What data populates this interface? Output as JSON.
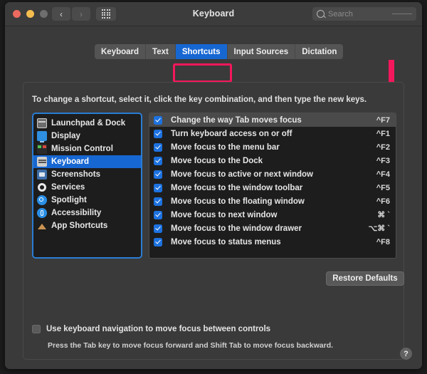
{
  "window": {
    "title": "Keyboard",
    "traffic_lights": [
      "close",
      "minimize",
      "zoom"
    ],
    "nav_back": "‹",
    "nav_forward": "›",
    "grid_button": "show-all-preferences"
  },
  "search": {
    "placeholder": "Search",
    "icon": "search-icon"
  },
  "tabs": [
    {
      "label": "Keyboard",
      "active": false
    },
    {
      "label": "Text",
      "active": false
    },
    {
      "label": "Shortcuts",
      "active": true
    },
    {
      "label": "Input Sources",
      "active": false
    },
    {
      "label": "Dictation",
      "active": false
    }
  ],
  "annotations": {
    "tab_highlight_color": "#f4175c",
    "arrow_color": "#f4175c",
    "arrow_target": "first-shortcut-row"
  },
  "instruction": "To change a shortcut, select it, click the key combination, and then type the new keys.",
  "sidebar": {
    "items": [
      {
        "label": "Launchpad & Dock",
        "icon": "launchpad-icon",
        "selected": false
      },
      {
        "label": "Display",
        "icon": "display-icon",
        "selected": false
      },
      {
        "label": "Mission Control",
        "icon": "mission-control-icon",
        "selected": false
      },
      {
        "label": "Keyboard",
        "icon": "keyboard-icon",
        "selected": true
      },
      {
        "label": "Screenshots",
        "icon": "screenshots-icon",
        "selected": false
      },
      {
        "label": "Services",
        "icon": "services-gear-icon",
        "selected": false
      },
      {
        "label": "Spotlight",
        "icon": "spotlight-icon",
        "selected": false
      },
      {
        "label": "Accessibility",
        "icon": "accessibility-icon",
        "selected": false
      },
      {
        "label": "App Shortcuts",
        "icon": "app-shortcuts-icon",
        "selected": false
      }
    ]
  },
  "shortcuts": {
    "rows": [
      {
        "label": "Change the way Tab moves focus",
        "key": "^F7",
        "checked": true,
        "selected": true
      },
      {
        "label": "Turn keyboard access on or off",
        "key": "^F1",
        "checked": true,
        "selected": false
      },
      {
        "label": "Move focus to the menu bar",
        "key": "^F2",
        "checked": true,
        "selected": false
      },
      {
        "label": "Move focus to the Dock",
        "key": "^F3",
        "checked": true,
        "selected": false
      },
      {
        "label": "Move focus to active or next window",
        "key": "^F4",
        "checked": true,
        "selected": false
      },
      {
        "label": "Move focus to the window toolbar",
        "key": "^F5",
        "checked": true,
        "selected": false
      },
      {
        "label": "Move focus to the floating window",
        "key": "^F6",
        "checked": true,
        "selected": false
      },
      {
        "label": "Move focus to next window",
        "key": "⌘ `",
        "checked": true,
        "selected": false
      },
      {
        "label": "Move focus to the window drawer",
        "key": "⌥⌘ `",
        "checked": true,
        "selected": false
      },
      {
        "label": "Move focus to status menus",
        "key": "^F8",
        "checked": true,
        "selected": false
      }
    ]
  },
  "restore_defaults_label": "Restore Defaults",
  "keyboard_navigation": {
    "label": "Use keyboard navigation to move focus between controls",
    "checked": false,
    "hint": "Press the Tab key to move focus forward and Shift Tab to move focus backward."
  },
  "help_label": "?",
  "colors": {
    "accent_blue": "#1767d2",
    "annotation_pink": "#f4175c",
    "window_bg": "#3a3a3a",
    "list_bg": "#1d1d1d"
  }
}
